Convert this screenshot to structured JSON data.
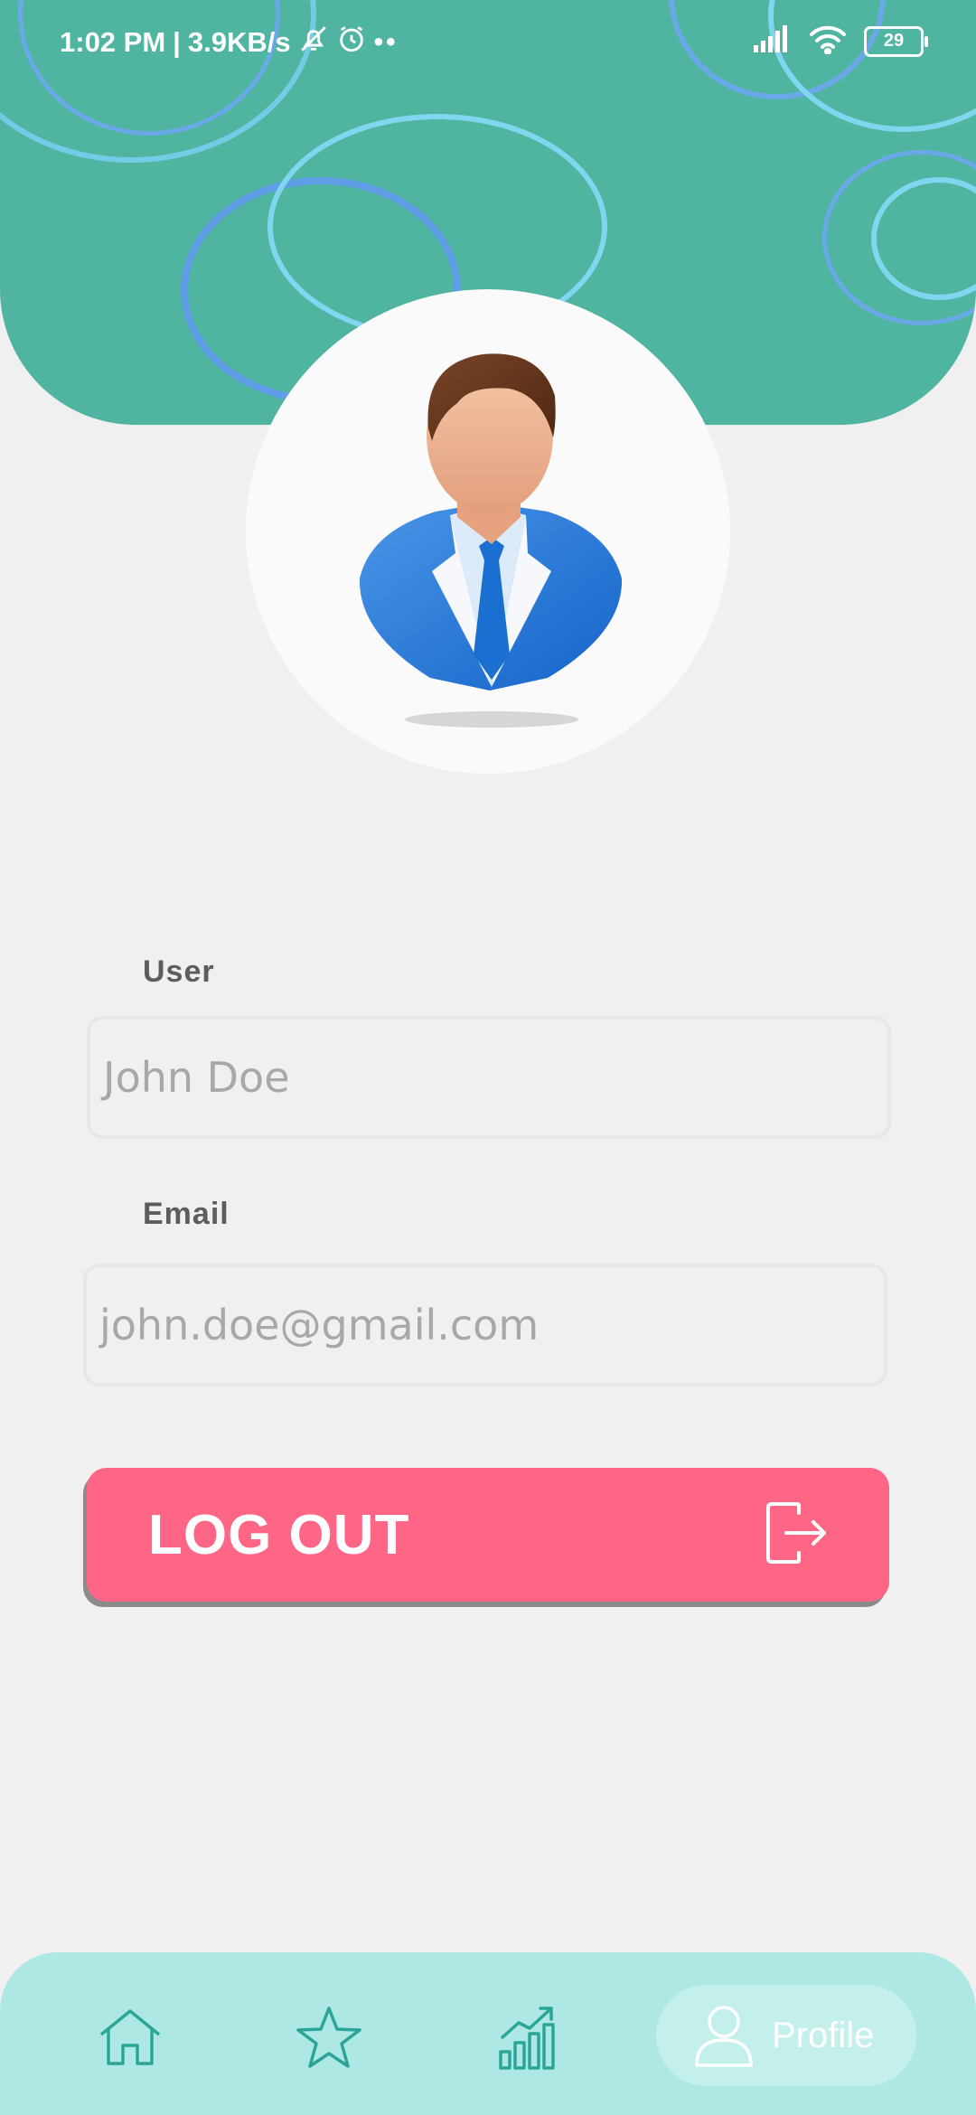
{
  "status_bar": {
    "time": "1:02 PM",
    "speed": "3.9KB/s",
    "battery": "29"
  },
  "profile": {
    "user_label": "User",
    "user_value": "John Doe",
    "email_label": "Email",
    "email_value": "john.doe@gmail.com",
    "logout_label": "LOG OUT"
  },
  "nav": {
    "items": [
      {
        "icon": "home-icon"
      },
      {
        "icon": "star-icon"
      },
      {
        "icon": "chart-icon"
      },
      {
        "icon": "profile-icon",
        "label": "Profile"
      }
    ]
  },
  "colors": {
    "header": "#4fb5a1",
    "logout": "#ff6584",
    "nav_bar": "#ade8e5",
    "nav_icon": "#2ba597"
  }
}
